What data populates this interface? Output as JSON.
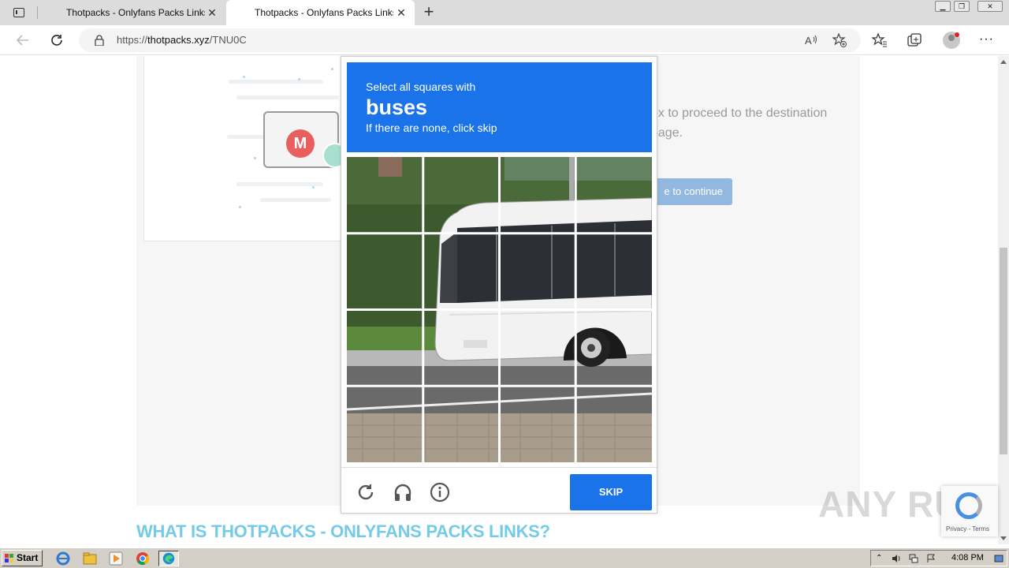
{
  "browser": {
    "tabs": [
      {
        "title": "Thotpacks - Onlyfans Packs Links",
        "active": false
      },
      {
        "title": "Thotpacks - Onlyfans Packs Links",
        "active": true
      }
    ],
    "url_prefix": "https://",
    "url_host": "thotpacks.xyz",
    "url_path": "/TNU0C"
  },
  "page": {
    "instruction_text": "ox to proceed to the destination page.",
    "continue_button": "e to continue",
    "what_heading": "WHAT IS THOTPACKS - ONLYFANS PACKS LINKS?",
    "mega_letter": "M"
  },
  "captcha": {
    "line1": "Select all squares with",
    "target": "buses",
    "line3": "If there are none, click skip",
    "skip_label": "SKIP",
    "accent": "#1a73e8"
  },
  "recaptcha_badge": {
    "text": "Privacy - Terms"
  },
  "watermark": "ANY RUN",
  "taskbar": {
    "start_label": "Start",
    "clock": "4:08 PM"
  }
}
